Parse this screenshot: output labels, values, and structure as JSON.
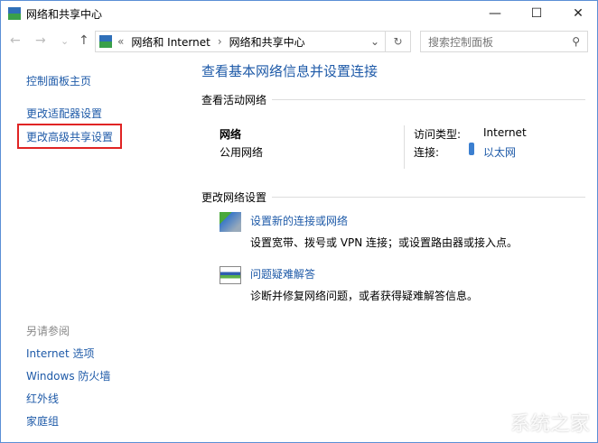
{
  "window": {
    "title": "网络和共享中心",
    "minimize": "—",
    "maximize": "☐",
    "close": "✕"
  },
  "toolbar": {
    "back": "←",
    "forward": "→",
    "recent": "⌄",
    "up": "↑",
    "breadcrumb": {
      "overflow": "«",
      "items": [
        "网络和 Internet",
        "网络和共享中心"
      ],
      "separator": "›"
    },
    "dropdown": "⌄",
    "refresh": "↻",
    "search_placeholder": "搜索控制面板",
    "search_icon": "⚲"
  },
  "sidebar": {
    "home": "控制面板主页",
    "items": [
      "更改适配器设置",
      "更改高级共享设置"
    ],
    "see_also_title": "另请参阅",
    "see_also": [
      "Internet 选项",
      "Windows 防火墙",
      "红外线",
      "家庭组"
    ]
  },
  "main": {
    "heading": "查看基本网络信息并设置连接",
    "active_section": "查看活动网络",
    "network": {
      "name": "网络",
      "type": "公用网络",
      "access_label": "访问类型:",
      "access_value": "Internet",
      "conn_label": "连接:",
      "conn_value": "以太网"
    },
    "change_section": "更改网络设置",
    "tasks": [
      {
        "title": "设置新的连接或网络",
        "desc": "设置宽带、拨号或 VPN 连接；或设置路由器或接入点。"
      },
      {
        "title": "问题疑难解答",
        "desc": "诊断并修复网络问题，或者获得疑难解答信息。"
      }
    ]
  },
  "watermark": "系统之家",
  "colors": {
    "link": "#1e5aa8",
    "highlight": "#e02424"
  }
}
